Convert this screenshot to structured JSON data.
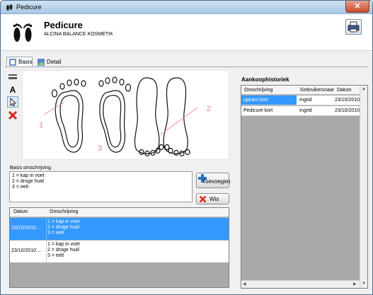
{
  "window": {
    "title": "Pedicure",
    "close_glyph": "✕"
  },
  "header": {
    "title": "Pedicure",
    "subtitle": "ALCINA BALANCE KOSMETIK"
  },
  "tabs": [
    {
      "label": "Basis",
      "icon": "pedicure-icon"
    },
    {
      "label": "Detail",
      "icon": "picture-icon"
    }
  ],
  "toolbar": {
    "text_tool": "A"
  },
  "diagram": {
    "markers": [
      "1",
      "2",
      "3"
    ],
    "marker_color": "#f27ab0"
  },
  "description": {
    "label": "Basis omschrijving",
    "value": "1 = kap in voet\n2 = droge huid\n3 = eelt",
    "add_button": "Toevoegen",
    "delete_button": "Wis"
  },
  "records": {
    "columns": [
      "Datum",
      "Omschrijving"
    ],
    "rows": [
      {
        "date": "23/10/2010 ...",
        "text": "1 = kap in voet\n2 = droge huid\n3 = eelt",
        "selected": true
      },
      {
        "date": "23/10/2010 ...",
        "text": "1 = kap in voet\n2 = droge huid\n3 = eelt",
        "selected": false
      }
    ]
  },
  "history": {
    "title": "Aankoophistoriek",
    "columns": [
      "Omschrijving",
      "Gebruikersnaar",
      "Datum"
    ],
    "rows": [
      {
        "description": "opkam kort",
        "user": "Ingrid",
        "date": "23/10/2010"
      },
      {
        "description": "Pedicure kort",
        "user": "Ingrid",
        "date": "23/10/2010"
      }
    ]
  },
  "colors": {
    "selection": "#3399ff",
    "accent_pink": "#f27ab0",
    "delete_red": "#d9261c"
  }
}
